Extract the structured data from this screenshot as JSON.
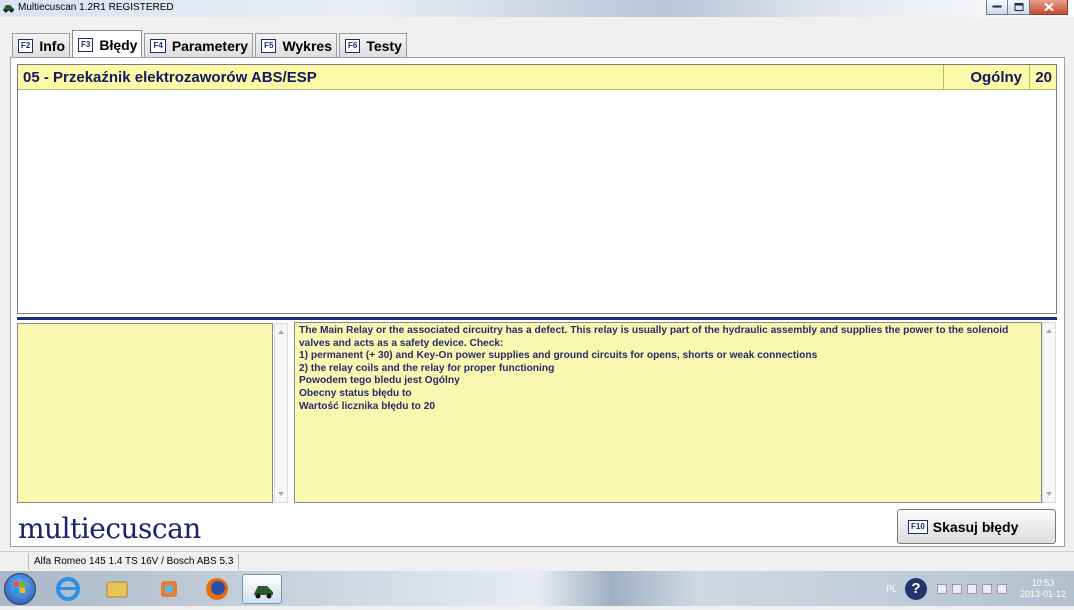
{
  "window": {
    "title": "Multiecuscan 1.2R1 REGISTERED"
  },
  "tabs": [
    {
      "key": "F2",
      "label": "Info",
      "active": false
    },
    {
      "key": "F3",
      "label": "Błędy",
      "active": true
    },
    {
      "key": "F4",
      "label": "Parametery",
      "active": false
    },
    {
      "key": "F5",
      "label": "Wykres",
      "active": false
    },
    {
      "key": "F6",
      "label": "Testy",
      "active": false
    }
  ],
  "fault": {
    "name": "05 - Przekaźnik elektrozaworów ABS/ESP",
    "category": "Ogólny",
    "count": "20"
  },
  "description": [
    "The Main Relay or the associated circuitry has a defect. This relay is usually part of the hydraulic assembly and supplies the power to the solenoid",
    "valves and acts as a safety device. Check:",
    "1) permanent (+ 30) and Key-On power supplies and ground circuits for opens, shorts or weak connections",
    "2) the relay coils and the relay for proper functioning",
    "Powodem tego bledu jest Ogólny",
    "Obecny status błędu to",
    "Wartość licznika błędu to 20"
  ],
  "brand": {
    "logo_text": "multiecuscan"
  },
  "actions": {
    "clear_key": "F10",
    "clear_label": "Skasuj błędy"
  },
  "status": {
    "vehicle": "Alfa Romeo 145 1.4 TS 16V / Bosch ABS 5.3"
  },
  "taskbar": {
    "lang": "PL",
    "time": "10:53",
    "date": "2013-01-12"
  },
  "colors": {
    "highlight": "#fafaa8",
    "text_navy": "#17175e",
    "divider": "#1d2a78"
  }
}
